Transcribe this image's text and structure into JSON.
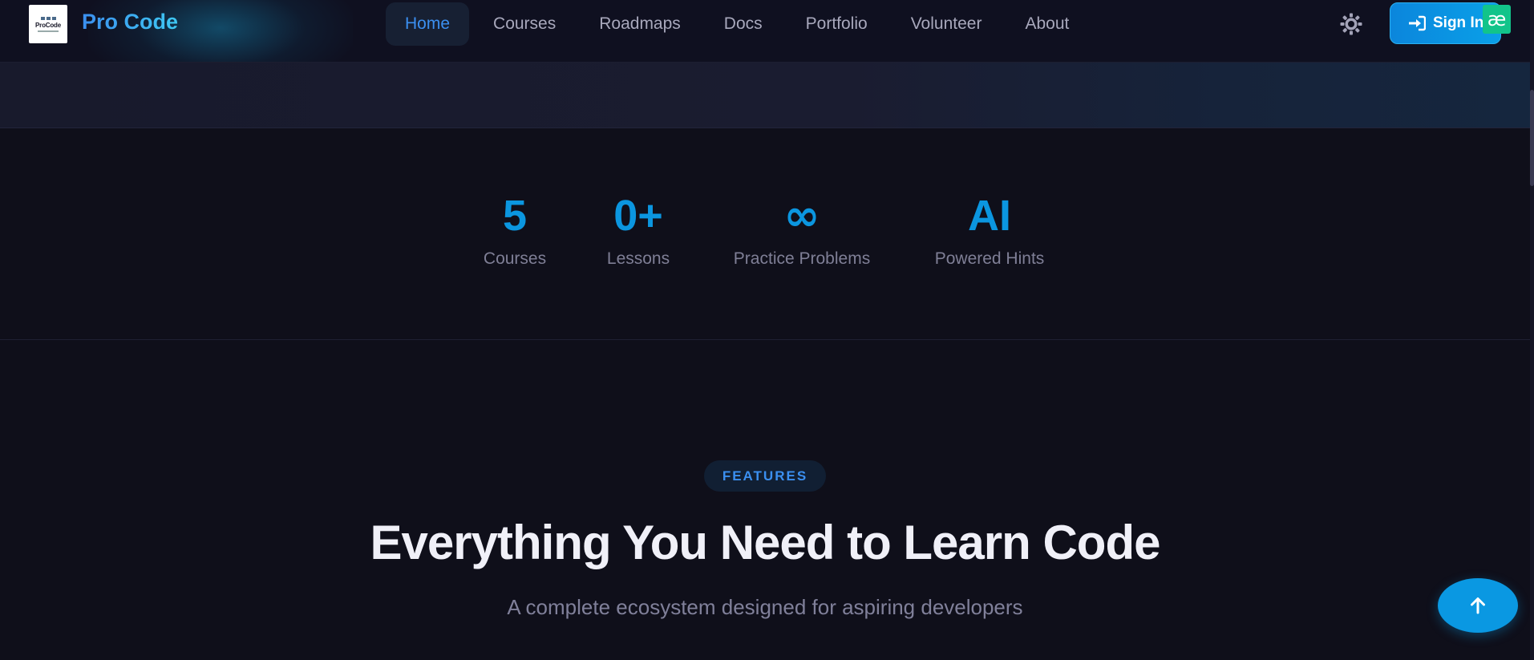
{
  "nav": {
    "brand": "Pro Code",
    "logo_text": "ProCode",
    "links": [
      {
        "label": "Home",
        "active": true
      },
      {
        "label": "Courses",
        "active": false
      },
      {
        "label": "Roadmaps",
        "active": false
      },
      {
        "label": "Docs",
        "active": false
      },
      {
        "label": "Portfolio",
        "active": false
      },
      {
        "label": "Volunteer",
        "active": false
      },
      {
        "label": "About",
        "active": false
      }
    ],
    "theme_icon": "sun-icon",
    "sign_in_label": "Sign In",
    "sign_in_icon": "sign-in-icon",
    "extension_badge": "æ"
  },
  "stats": [
    {
      "value": "5",
      "label": "Courses"
    },
    {
      "value": "0+",
      "label": "Lessons"
    },
    {
      "value": "∞",
      "label": "Practice Problems"
    },
    {
      "value": "AI",
      "label": "Powered Hints"
    }
  ],
  "features": {
    "pill": "FEATURES",
    "title": "Everything You Need to Learn Code",
    "subtitle": "A complete ecosystem designed for aspiring developers"
  },
  "scroll_top_icon": "arrow-up-icon",
  "colors": {
    "background": "#0f0f1a",
    "accent": "#0b96e0",
    "brand_gradient_start": "#3b8ff0",
    "brand_gradient_end": "#3ec8f2",
    "nav_active_bg": "#172033",
    "muted_text": "#7f7f96"
  }
}
